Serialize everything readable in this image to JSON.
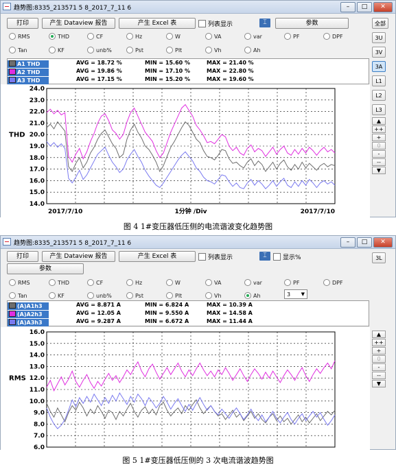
{
  "panel1": {
    "title": "趋势图:8335_213571 5 8_2017_7_11 6",
    "toolbar": {
      "print": "打印",
      "dataview": "产生 Dataview 报告",
      "excel": "产生 Excel 表",
      "list_display": "列表显示",
      "params": "参数"
    },
    "radios_row1": [
      "RMS",
      "THD",
      "CF",
      "Hz",
      "W",
      "VA",
      "var",
      "PF",
      "DPF"
    ],
    "radios_row2": [
      "Tan",
      "KF",
      "unb%",
      "Pst",
      "Plt",
      "Vh",
      "Ah"
    ],
    "selected": "THD",
    "side_buttons": [
      "全部",
      "3U",
      "3V",
      "3A",
      "L1",
      "L2",
      "L3"
    ],
    "scroll_buttons": [
      "▲",
      "++",
      "+",
      "0",
      "-",
      "--",
      "▼"
    ],
    "legend": [
      {
        "name": "A1 THD",
        "color": "#6e6e6e",
        "avg": "AVG = 18.72 %",
        "min": "MIN = 15.60 %",
        "max": "MAX = 21.40 %"
      },
      {
        "name": "A2 THD",
        "color": "#e02ee0",
        "avg": "AVG = 19.86 %",
        "min": "MIN = 17.10 %",
        "max": "MAX = 22.80 %"
      },
      {
        "name": "A3 THD",
        "color": "#7a7af0",
        "avg": "AVG = 17.15 %",
        "min": "MIN = 15.20 %",
        "max": "MAX = 19.60 %"
      }
    ],
    "y_axis_label": "THD",
    "x_date_left": "2017/7/10",
    "x_center": "1分钟 /Div",
    "x_date_right": "2017/7/10",
    "caption": "图 4    1#变压器低压侧的电流谐波变化趋势图"
  },
  "panel2": {
    "title": "趋势图:8335_213571 5 8_2017_7_11 6",
    "toolbar": {
      "print": "打印",
      "dataview": "产生 Dataview 报告",
      "excel": "产生 Excel 表",
      "list_display": "列表显示",
      "show_percent": "显示%",
      "params": "参数"
    },
    "radios_row1": [
      "RMS",
      "THD",
      "CF",
      "Hz",
      "W",
      "VA",
      "var",
      "PF",
      "DPF"
    ],
    "radios_row2": [
      "Tan",
      "KF",
      "unb%",
      "Pst",
      "Plt",
      "Vh",
      "Ah"
    ],
    "selected": "Ah",
    "harmonic_order": "3",
    "side_buttons": [
      "3L"
    ],
    "scroll_buttons": [
      "▲",
      "++",
      "+",
      "0",
      "-",
      "--",
      "▼"
    ],
    "legend": [
      {
        "name": "(A)A1h3",
        "color": "#6e6e6e",
        "avg": "AVG = 8.871 A",
        "min": "MIN = 6.824 A",
        "max": "MAX = 10.39 A"
      },
      {
        "name": "(A)A2h3",
        "color": "#e02ee0",
        "avg": "AVG = 12.05 A",
        "min": "MIN = 9.550 A",
        "max": "MAX = 14.58 A"
      },
      {
        "name": "(A)A3h3",
        "color": "#7a7af0",
        "avg": "AVG = 9.287 A",
        "min": "MIN = 6.672 A",
        "max": "MAX = 11.44 A"
      }
    ],
    "y_axis_label": "RMS",
    "caption": "图 5    1#变压器低压侧的 3 次电流谐波趋势图"
  },
  "chart_data": [
    {
      "type": "line",
      "ylabel": "THD",
      "xlabel": "1分钟 /Div",
      "ylim": [
        14.0,
        24.0
      ],
      "y_ticks": [
        "24.0",
        "23.0",
        "22.0",
        "21.0",
        "20.0",
        "19.0",
        "18.0",
        "17.0",
        "16.0",
        "15.0",
        "14.0"
      ],
      "x": [
        0,
        1,
        2,
        3,
        4,
        5,
        6,
        7,
        8,
        9,
        10,
        11,
        12,
        13,
        14,
        15,
        16,
        17,
        18,
        19,
        20,
        21,
        22,
        23,
        24,
        25,
        26,
        27,
        28,
        29,
        30,
        31,
        32,
        33,
        34,
        35,
        36,
        37,
        38,
        39,
        40,
        41,
        42,
        43,
        44,
        45,
        46,
        47,
        48,
        49,
        50,
        51,
        52,
        53,
        54,
        55,
        56,
        57,
        58,
        59,
        60,
        61,
        62,
        63,
        64,
        65,
        66,
        67,
        68,
        69,
        70,
        71,
        72,
        73,
        74,
        75,
        76,
        77,
        78,
        79
      ],
      "series": [
        {
          "name": "A1 THD",
          "color": "#6e6e6e",
          "values": [
            20.6,
            20.9,
            20.5,
            21.1,
            20.7,
            20.3,
            17.2,
            16.8,
            17.5,
            18.0,
            17.1,
            17.6,
            18.4,
            18.9,
            19.6,
            20.1,
            20.4,
            19.8,
            19.2,
            18.8,
            18.0,
            18.3,
            19.6,
            20.4,
            20.9,
            20.2,
            19.7,
            19.0,
            18.7,
            18.2,
            17.6,
            16.8,
            17.3,
            18.1,
            18.9,
            19.4,
            20.0,
            20.6,
            21.1,
            20.8,
            20.2,
            19.6,
            19.3,
            18.6,
            18.1,
            18.0,
            17.8,
            18.2,
            18.7,
            18.6,
            17.9,
            17.5,
            17.6,
            17.3,
            17.1,
            17.6,
            17.9,
            17.3,
            17.7,
            17.4,
            16.8,
            17.2,
            17.6,
            17.0,
            17.5,
            17.8,
            17.2,
            16.9,
            17.4,
            17.0,
            17.6,
            17.1,
            17.5,
            17.2,
            16.9,
            17.3,
            17.5,
            17.2,
            17.4,
            17.3
          ]
        },
        {
          "name": "A2 THD",
          "color": "#e02ee0",
          "values": [
            21.9,
            22.2,
            21.8,
            22.1,
            21.7,
            21.9,
            18.1,
            17.6,
            18.3,
            18.8,
            17.9,
            18.5,
            19.4,
            20.1,
            21.0,
            21.6,
            21.8,
            21.2,
            20.4,
            20.1,
            19.6,
            20.0,
            21.1,
            21.9,
            22.3,
            21.6,
            20.9,
            20.2,
            19.8,
            19.4,
            18.6,
            18.0,
            18.4,
            19.3,
            20.2,
            20.9,
            21.6,
            22.3,
            22.6,
            22.1,
            21.6,
            20.8,
            20.4,
            19.9,
            19.3,
            19.4,
            19.2,
            19.6,
            20.0,
            19.8,
            19.0,
            18.6,
            18.9,
            18.4,
            18.2,
            18.8,
            19.1,
            18.5,
            18.8,
            18.6,
            18.1,
            18.5,
            18.9,
            18.3,
            18.7,
            19.0,
            18.4,
            18.2,
            18.7,
            18.3,
            18.8,
            18.4,
            18.9,
            18.6,
            18.2,
            18.6,
            18.9,
            18.5,
            18.7,
            18.4
          ]
        },
        {
          "name": "A3 THD",
          "color": "#7a7af0",
          "values": [
            19.4,
            19.0,
            19.3,
            18.9,
            19.2,
            18.8,
            16.2,
            15.8,
            16.3,
            16.9,
            16.1,
            16.5,
            17.1,
            17.7,
            18.3,
            18.6,
            18.9,
            18.2,
            17.6,
            17.2,
            16.7,
            17.0,
            17.8,
            18.3,
            18.7,
            18.1,
            17.6,
            16.9,
            16.4,
            16.0,
            15.6,
            15.4,
            15.8,
            16.3,
            16.8,
            17.3,
            17.8,
            18.2,
            18.5,
            18.1,
            17.7,
            17.1,
            16.8,
            16.3,
            16.0,
            15.9,
            15.7,
            16.1,
            16.5,
            16.4,
            15.9,
            15.5,
            15.8,
            15.4,
            15.3,
            15.8,
            16.1,
            15.6,
            16.0,
            15.7,
            15.3,
            15.6,
            16.0,
            15.5,
            15.9,
            16.2,
            15.6,
            15.4,
            15.9,
            15.5,
            16.0,
            15.6,
            16.1,
            15.8,
            15.4,
            15.8,
            16.0,
            15.7,
            15.9,
            15.6
          ]
        }
      ]
    },
    {
      "type": "line",
      "ylabel": "RMS",
      "ylim": [
        6.0,
        16.0
      ],
      "y_ticks": [
        "16.0",
        "15.0",
        "14.0",
        "13.0",
        "12.0",
        "11.0",
        "10.0",
        "9.0",
        "8.0",
        "7.0",
        "6.0"
      ],
      "x": [
        0,
        1,
        2,
        3,
        4,
        5,
        6,
        7,
        8,
        9,
        10,
        11,
        12,
        13,
        14,
        15,
        16,
        17,
        18,
        19,
        20,
        21,
        22,
        23,
        24,
        25,
        26,
        27,
        28,
        29,
        30,
        31,
        32,
        33,
        34,
        35,
        36,
        37,
        38,
        39,
        40,
        41,
        42,
        43,
        44,
        45,
        46,
        47,
        48,
        49,
        50,
        51,
        52,
        53,
        54,
        55,
        56,
        57,
        58,
        59,
        60,
        61,
        62,
        63,
        64,
        65,
        66,
        67,
        68,
        69,
        70,
        71,
        72,
        73,
        74,
        75,
        76,
        77,
        78,
        79
      ],
      "series": [
        {
          "name": "(A)A1h3",
          "color": "#6e6e6e",
          "values": [
            9.8,
            9.1,
            8.6,
            9.4,
            8.8,
            8.2,
            9.0,
            9.6,
            9.2,
            9.9,
            9.4,
            8.7,
            9.3,
            8.9,
            9.6,
            9.1,
            8.5,
            9.2,
            9.0,
            8.4,
            9.1,
            8.7,
            9.3,
            9.8,
            9.1,
            8.6,
            9.2,
            9.5,
            8.9,
            9.3,
            8.8,
            9.6,
            9.9,
            9.2,
            8.7,
            9.1,
            9.4,
            8.9,
            9.6,
            9.2,
            9.7,
            10.1,
            9.4,
            8.9,
            9.3,
            9.6,
            9.1,
            8.7,
            8.9,
            8.4,
            8.8,
            9.2,
            8.6,
            8.9,
            8.3,
            8.7,
            9.1,
            8.5,
            8.9,
            8.4,
            8.1,
            8.6,
            8.9,
            8.3,
            8.7,
            8.2,
            8.5,
            8.0,
            8.4,
            8.8,
            8.2,
            8.6,
            8.1,
            8.5,
            8.9,
            8.3,
            8.7,
            9.1,
            8.8,
            9.2
          ]
        },
        {
          "name": "(A)A2h3",
          "color": "#e02ee0",
          "values": [
            11.2,
            11.8,
            10.9,
            11.5,
            12.1,
            11.4,
            11.9,
            12.6,
            11.7,
            11.2,
            11.8,
            12.3,
            11.6,
            11.1,
            11.7,
            11.3,
            11.9,
            12.4,
            11.8,
            12.2,
            11.6,
            12.1,
            12.7,
            12.3,
            12.9,
            13.4,
            12.6,
            12.1,
            12.8,
            13.2,
            12.5,
            11.9,
            12.4,
            12.9,
            12.3,
            12.8,
            13.3,
            12.6,
            12.1,
            12.7,
            12.2,
            12.8,
            13.3,
            12.7,
            12.2,
            12.6,
            12.1,
            12.7,
            12.3,
            12.9,
            12.4,
            11.8,
            12.3,
            12.8,
            12.2,
            11.7,
            12.3,
            12.8,
            12.4,
            11.9,
            12.5,
            12.0,
            12.6,
            12.1,
            11.6,
            12.2,
            12.7,
            12.3,
            11.8,
            12.4,
            12.9,
            12.2,
            11.7,
            12.3,
            12.8,
            12.4,
            12.9,
            13.3,
            12.8,
            13.5
          ]
        },
        {
          "name": "(A)A3h3",
          "color": "#7a7af0",
          "values": [
            9.4,
            8.6,
            8.0,
            7.6,
            7.9,
            8.4,
            9.2,
            10.1,
            9.5,
            10.3,
            9.8,
            10.4,
            9.9,
            10.6,
            10.1,
            9.6,
            10.3,
            9.8,
            10.5,
            10.0,
            10.7,
            10.2,
            9.7,
            10.4,
            9.9,
            10.6,
            10.2,
            9.6,
            10.3,
            9.9,
            9.4,
            9.8,
            10.4,
            9.9,
            9.3,
            9.8,
            10.2,
            9.6,
            9.1,
            9.7,
            9.2,
            9.8,
            10.3,
            9.7,
            9.2,
            9.6,
            9.1,
            8.8,
            9.3,
            8.9,
            8.5,
            9.0,
            9.4,
            8.9,
            8.4,
            8.8,
            9.3,
            8.7,
            8.3,
            8.8,
            8.2,
            8.6,
            9.1,
            8.5,
            8.1,
            8.6,
            9.0,
            8.4,
            8.0,
            8.5,
            8.9,
            8.3,
            8.7,
            9.1,
            8.6,
            9.0,
            8.4,
            7.9,
            8.3,
            8.8
          ]
        }
      ]
    }
  ]
}
